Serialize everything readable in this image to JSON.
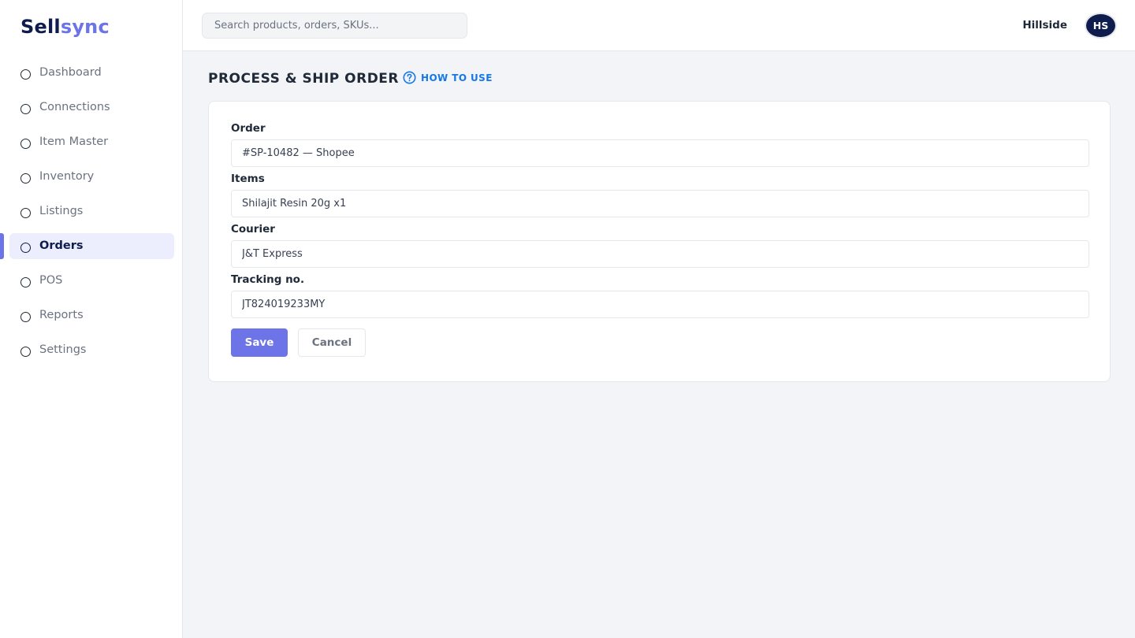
{
  "brand": {
    "part1": "Sell",
    "part2": "sync"
  },
  "sidebar": {
    "items": [
      {
        "label": "Dashboard",
        "icon": "circle-icon",
        "active": false
      },
      {
        "label": "Connections",
        "icon": "circle-icon",
        "active": false
      },
      {
        "label": "Item Master",
        "icon": "circle-icon",
        "active": false
      },
      {
        "label": "Inventory",
        "icon": "circle-icon",
        "active": false
      },
      {
        "label": "Listings",
        "icon": "circle-icon",
        "active": false
      },
      {
        "label": "Orders",
        "icon": "circle-icon",
        "active": true
      },
      {
        "label": "POS",
        "icon": "circle-icon",
        "active": false
      },
      {
        "label": "Reports",
        "icon": "circle-icon",
        "active": false
      },
      {
        "label": "Settings",
        "icon": "circle-icon",
        "active": false
      }
    ]
  },
  "header": {
    "search_placeholder": "Search products, orders, SKUs...",
    "store_name": "Hillside",
    "avatar_initials": "HS"
  },
  "page": {
    "title": "PROCESS & SHIP ORDER",
    "help_link": "HOW TO USE",
    "help_icon": "question-circle-icon"
  },
  "form": {
    "order_label": "Order",
    "order_value": "#SP-10482 — Shopee",
    "items_label": "Items",
    "items_value": "Shilajit Resin 20g x1",
    "courier_label": "Courier",
    "courier_value": "J&T Express",
    "tracking_label": "Tracking no.",
    "tracking_value": "JT824019233MY",
    "save_label": "Save",
    "cancel_label": "Cancel"
  },
  "colors": {
    "brand_dark": "#0f1d4e",
    "accent": "#6d74e8",
    "link": "#1677e8",
    "background": "#f2f4f8"
  }
}
